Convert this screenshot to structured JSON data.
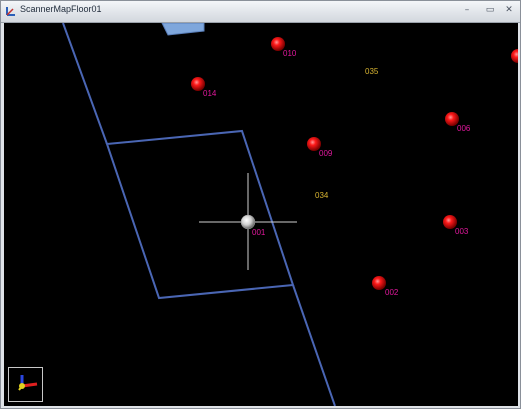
{
  "window": {
    "title": "ScannerMapFloor01",
    "icon": "axes-app-icon",
    "controls": [
      "minimize",
      "restore",
      "close"
    ],
    "control_glyphs": {
      "minimize": "–",
      "restore": "▭",
      "close": "✕"
    }
  },
  "viewport": {
    "background": "#000000",
    "floor_outline_color": "#4a66b4",
    "zone_outline_color": "#4a66b4",
    "box_color": "#7fa7dc"
  },
  "scanner_points": [
    {
      "id": "010",
      "active": true
    },
    {
      "id": "014",
      "active": true
    },
    {
      "id": "009",
      "active": true
    },
    {
      "id": "006",
      "active": true
    },
    {
      "id": "003",
      "active": true
    },
    {
      "id": "002",
      "active": true
    },
    {
      "id": "001",
      "active": true,
      "selected": true
    }
  ],
  "marker_labels": [
    "035",
    "034"
  ],
  "colors": {
    "point_red": "#ff1a1a",
    "point_label": "#e0189c",
    "marker_label": "#d8b431",
    "crosshair": "#d0d0d0"
  },
  "axis_widget": {
    "icon": "axis-gizmo-icon"
  }
}
